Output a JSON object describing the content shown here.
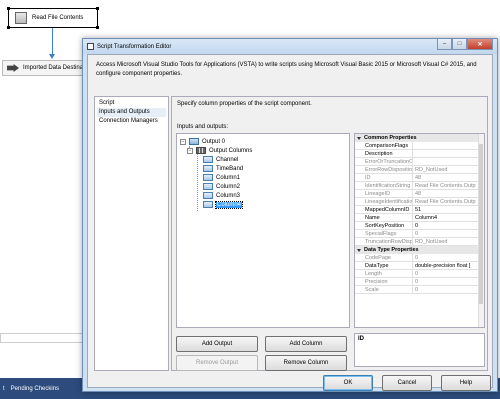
{
  "background": {
    "task_label": "Read File Contents",
    "destination_label": "Imported Data Destina",
    "taskbar_items": [
      "t",
      "Pending Checkins"
    ]
  },
  "dialog": {
    "title": "Script Transformation Editor",
    "intro": "Access Microsoft Visual Studio Tools for Applications (VSTA) to write scripts using Microsoft Visual Basic 2015 or Microsoft Visual C# 2015, and configure component properties.",
    "nav": {
      "items": [
        "Script",
        "Inputs and Outputs",
        "Connection Managers"
      ],
      "selected": "Inputs and Outputs"
    },
    "description": "Specify column properties of the script component.",
    "io_label": "Inputs and outputs:",
    "tree": {
      "output": "Output 0",
      "columns_folder": "Output Columns",
      "columns": [
        "Channel",
        "TimeBand",
        "Column1",
        "Column2",
        "Column3",
        "Column4"
      ],
      "selected": "Column4"
    },
    "properties": {
      "common_title": "Common Properties",
      "common": [
        {
          "key": "ComparisonFlags",
          "value": "",
          "readonly": false
        },
        {
          "key": "Description",
          "value": "",
          "readonly": false
        },
        {
          "key": "ErrorOrTruncationO",
          "value": "",
          "readonly": true
        },
        {
          "key": "ErrorRowDispositio",
          "value": "RD_NotUsed",
          "readonly": true
        },
        {
          "key": "ID",
          "value": "48",
          "readonly": true
        },
        {
          "key": "IdentificationString",
          "value": "Read File Contents.Outp",
          "readonly": true
        },
        {
          "key": "LineageID",
          "value": "48",
          "readonly": true
        },
        {
          "key": "LineageIdentificatio",
          "value": "Read File Contents.Outp",
          "readonly": true
        },
        {
          "key": "MappedColumnID",
          "value": "51",
          "readonly": false
        },
        {
          "key": "Name",
          "value": "Column4",
          "readonly": false
        },
        {
          "key": "SortKeyPosition",
          "value": "0",
          "readonly": false
        },
        {
          "key": "SpecialFlags",
          "value": "0",
          "readonly": true
        },
        {
          "key": "TruncationRowDisp",
          "value": "RD_NotUsed",
          "readonly": true
        }
      ],
      "datatype_title": "Data Type Properties",
      "datatype": [
        {
          "key": "CodePage",
          "value": "0",
          "readonly": true
        },
        {
          "key": "DataType",
          "value": "double-precision float [",
          "readonly": false
        },
        {
          "key": "Length",
          "value": "0",
          "readonly": true
        },
        {
          "key": "Precision",
          "value": "0",
          "readonly": true
        },
        {
          "key": "Scale",
          "value": "0",
          "readonly": true
        }
      ],
      "description_label": "ID"
    },
    "buttons": {
      "add_output": "Add Output",
      "add_column": "Add Column",
      "remove_output": "Remove Output",
      "remove_column": "Remove Column",
      "ok": "OK",
      "cancel": "Cancel",
      "help": "Help"
    }
  }
}
